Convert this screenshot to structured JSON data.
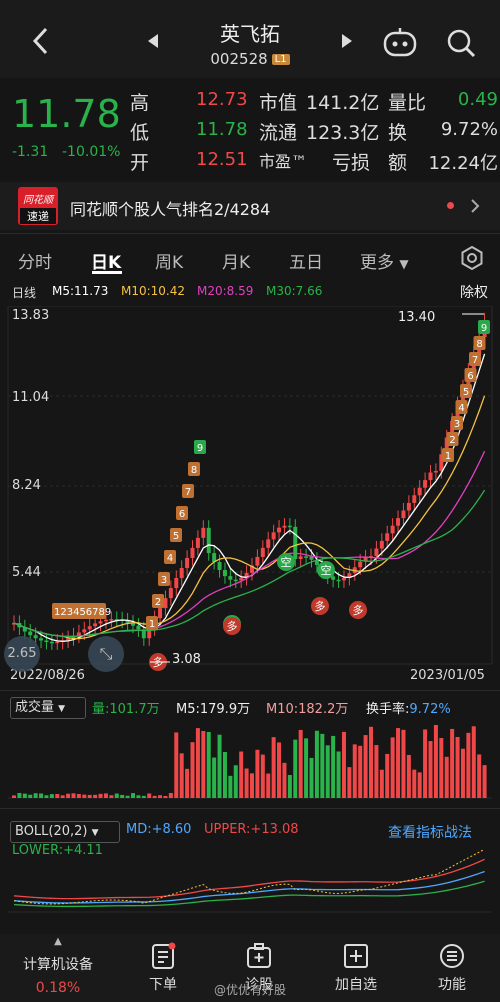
{
  "header": {
    "title": "英飞拓",
    "code": "002528",
    "level_badge": "L1"
  },
  "quote": {
    "price": "11.78",
    "change": "-1.31",
    "change_pct": "-10.01%",
    "high_label": "高",
    "high": "12.73",
    "low_label": "低",
    "low": "11.78",
    "open_label": "开",
    "open": "12.51",
    "mcap_label": "市值",
    "mcap": "141.2亿",
    "float_label": "流通",
    "float": "123.3亿",
    "pe_label": "市盈™",
    "pe": "亏损",
    "vr_label": "量比",
    "vr": "0.49",
    "turn_label": "换",
    "turn": "9.72%",
    "amt_label": "额",
    "amt": "12.24亿"
  },
  "rank": {
    "logo_top": "同花顺",
    "logo_bottom": "速递",
    "text": "同花顺个股人气排名2/4284"
  },
  "tabs": [
    "分时",
    "日K",
    "周K",
    "月K",
    "五日",
    "更多"
  ],
  "ma": {
    "period": "日线",
    "m5": "M5:11.73",
    "m10": "M10:10.42",
    "m20": "M20:8.59",
    "m30": "M30:7.66",
    "adj": "除权"
  },
  "kline": {
    "y_ticks": [
      "13.83",
      "11.04",
      "8.24",
      "5.44"
    ],
    "x_start": "2022/08/26",
    "x_end": "2023/01/05",
    "max_label": "13.40",
    "min_label": "3.08",
    "bubble_left": "2.65",
    "kong": "空",
    "duo": "多",
    "seq_left": [
      "1",
      "2",
      "3",
      "4",
      "5",
      "6",
      "7",
      "8",
      "9"
    ],
    "seq_mid": [
      "1",
      "2",
      "3",
      "4",
      "5",
      "6",
      "7",
      "8",
      "9"
    ],
    "seq_right": [
      "1",
      "2",
      "3",
      "4",
      "5",
      "6",
      "7",
      "8",
      "9"
    ],
    "small_seq": "123456789"
  },
  "volume": {
    "label": "成交量",
    "vol": "量:101.7万",
    "m5": "M5:179.9万",
    "m10": "M10:182.2万",
    "turn_label": "换手率:",
    "turn": "9.72%"
  },
  "boll": {
    "label": "BOLL(20,2)",
    "md": "MD:+8.60",
    "upper": "UPPER:+13.08",
    "lower": "LOWER:+4.11",
    "link": "查看指标战法"
  },
  "bottom": {
    "sector": "计算机设备",
    "sector_pct": "0.18%",
    "items": [
      "下单",
      "诊股",
      "加自选",
      "功能"
    ],
    "watermark": "@优优有好股"
  },
  "chart_data": {
    "type": "candlestick",
    "x_range": [
      "2022/08/26",
      "2023/01/05"
    ],
    "ylim": [
      2.65,
      13.83
    ],
    "annotations": {
      "max": 13.4,
      "min": 3.08
    }
  },
  "colors": {
    "up": "#f04848",
    "down": "#29b34a",
    "bg": "#161616",
    "m5": "#ffffff",
    "m10": "#f5c242",
    "m20": "#e040c0",
    "m30": "#29b34a"
  }
}
